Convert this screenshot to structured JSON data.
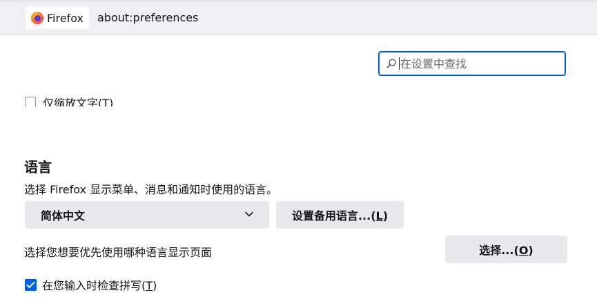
{
  "urlbar": {
    "identity_label": "Firefox",
    "url": "about:preferences"
  },
  "search": {
    "placeholder": "在设置中查找"
  },
  "clipped_option": {
    "label": "仅缩放文字(T)"
  },
  "language": {
    "heading": "语言",
    "description": "选择 Firefox 显示菜单、消息和通知时使用的语言。",
    "selected_language": "简体中文",
    "alternatives_button": {
      "text": "设置备用语言...(",
      "key": "L",
      "tail": ")"
    },
    "page_language_text": "选择您想要优先使用哪种语言显示页面",
    "choose_button": {
      "text": "选择...(",
      "key": "O",
      "tail": ")"
    },
    "spellcheck": {
      "text": "在您输入时检查拼写(",
      "key": "T",
      "tail": ")",
      "checked": true
    }
  },
  "colors": {
    "accent": "#0061e0",
    "button_bg": "#e9e9ed",
    "text": "#15141a"
  }
}
